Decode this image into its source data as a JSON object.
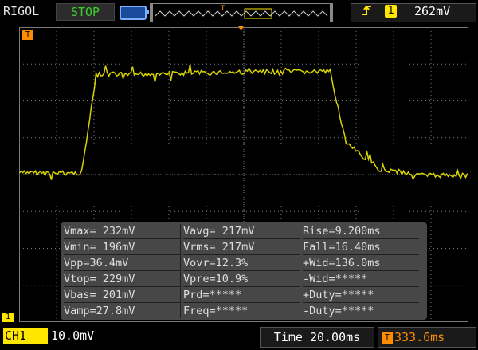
{
  "header": {
    "brand": "RIGOL",
    "run_state": "STOP",
    "trigger_edge_icon": "rising-edge-icon",
    "trigger_channel": "1",
    "trigger_level": "262mV"
  },
  "markers": {
    "trigger_position": "T",
    "channel_marker": "T",
    "ground_marker": "1"
  },
  "measurements": [
    [
      "Vmax= 232mV",
      "Vavg= 217mV",
      "Rise=9.200ms"
    ],
    [
      "Vmin= 196mV",
      "Vrms= 217mV",
      "Fall=16.40ms"
    ],
    [
      "Vpp=36.4mV",
      "Vovr=12.3%",
      "+Wid=136.0ms"
    ],
    [
      "Vtop= 229mV",
      "Vpre=10.9%",
      "-Wid=*****"
    ],
    [
      "Vbas= 201mV",
      "Prd=*****",
      "+Duty=*****"
    ],
    [
      "Vamp=27.8mV",
      "Freq=*****",
      "-Duty=*****"
    ]
  ],
  "footer": {
    "channel": "CH1",
    "channel_scale": "10.0mV",
    "timebase": "Time 20.00ms",
    "trigger_offset": "333.6ms"
  },
  "colors": {
    "trace": "#d8d400",
    "grid": "#7a7a7a",
    "accent_orange": "#ff8c00",
    "run_green": "#3cd22a"
  }
}
